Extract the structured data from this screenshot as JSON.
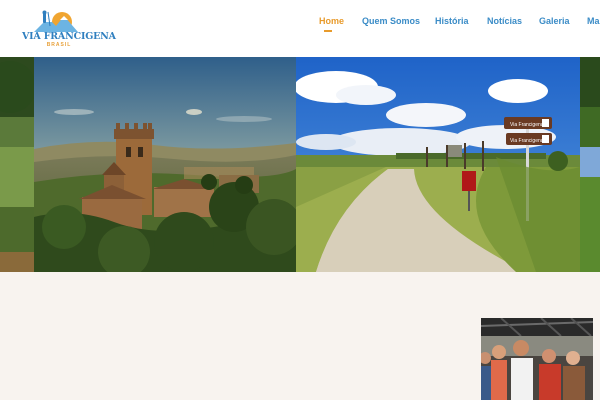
{
  "header": {
    "logo": {
      "title": "VIA FRANCIGENA",
      "subtitle": "BRASIL",
      "icon": "pilgrim-mountain-logo"
    },
    "nav": [
      {
        "label": "Home",
        "active": true
      },
      {
        "label": "Quem Somos",
        "active": false
      },
      {
        "label": "História",
        "active": false
      },
      {
        "label": "Notícias",
        "active": false
      },
      {
        "label": "Galeria",
        "active": false
      },
      {
        "label": "Ma",
        "active": false
      }
    ]
  },
  "hero": {
    "signpost_top": "Via Francigena",
    "signpost_bottom": "Via Francigena"
  },
  "colors": {
    "nav_text": "#3b8cc7",
    "nav_active": "#e89b2c",
    "section_bg": "#f8f3ef"
  }
}
